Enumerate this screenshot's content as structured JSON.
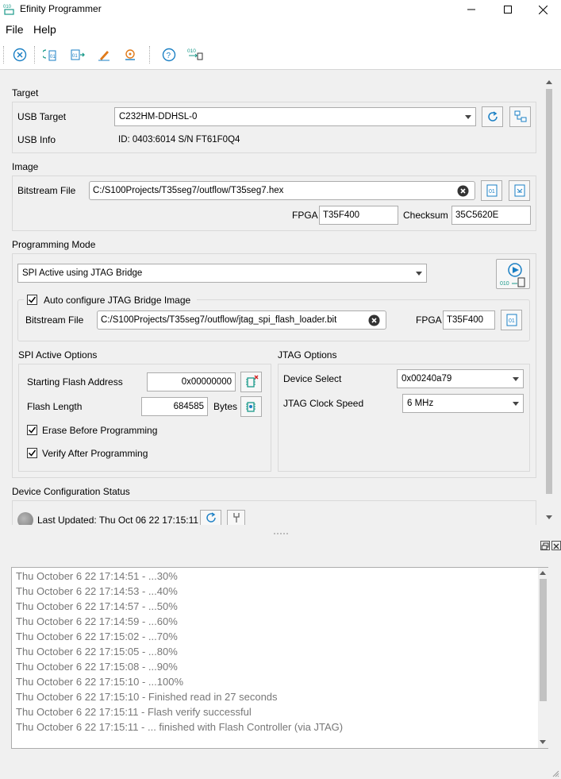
{
  "window": {
    "title": "Efinity Programmer"
  },
  "menu": {
    "items": [
      {
        "label": "File"
      },
      {
        "label": "Help"
      }
    ]
  },
  "target": {
    "section_title": "Target",
    "usb_target_label": "USB Target",
    "usb_target_value": "C232HM-DDHSL-0",
    "usb_info_label": "USB Info",
    "usb_info_value": "ID: 0403:6014 S/N FT61F0Q4"
  },
  "image": {
    "section_title": "Image",
    "bitstream_label": "Bitstream File",
    "bitstream_value": "C:/S100Projects/T35seg7/outflow/T35seg7.hex",
    "fpga_label": "FPGA",
    "fpga_value": "T35F400",
    "checksum_label": "Checksum",
    "checksum_value": "35C5620E"
  },
  "programming_mode": {
    "section_title": "Programming Mode",
    "mode_value": "SPI Active using JTAG Bridge",
    "auto_config_label": "Auto configure JTAG Bridge Image",
    "auto_config_checked": true,
    "bridge_bitstream_label": "Bitstream File",
    "bridge_bitstream_value": "C:/S100Projects/T35seg7/outflow/jtag_spi_flash_loader.bit",
    "bridge_fpga_label": "FPGA",
    "bridge_fpga_value": "T35F400",
    "program_icon_text": "010"
  },
  "spi_options": {
    "section_title": "SPI Active Options",
    "start_addr_label": "Starting Flash Address",
    "start_addr_value": "0x00000000",
    "flash_length_label": "Flash Length",
    "flash_length_value": "684585",
    "flash_length_unit": "Bytes",
    "erase_label": "Erase Before Programming",
    "erase_checked": true,
    "verify_label": "Verify After Programming",
    "verify_checked": true
  },
  "jtag_options": {
    "section_title": "JTAG Options",
    "device_select_label": "Device Select",
    "device_select_value": "0x00240a79",
    "clock_label": "JTAG Clock Speed",
    "clock_value": "6 MHz"
  },
  "device_status": {
    "section_title": "Device Configuration Status",
    "last_updated": "Last Updated: Thu Oct 06 22 17:15:11"
  },
  "toolbar_icons": {
    "bin_text_1": "01",
    "bin_text_2": "01",
    "bin_text_3": "010"
  },
  "log": {
    "lines": [
      "Thu October 6 22 17:14:51 - ...30%",
      "Thu October 6 22 17:14:53 - ...40%",
      "Thu October 6 22 17:14:57 - ...50%",
      "Thu October 6 22 17:14:59 - ...60%",
      "Thu October 6 22 17:15:02 - ...70%",
      "Thu October 6 22 17:15:05 - ...80%",
      "Thu October 6 22 17:15:08 - ...90%",
      "Thu October 6 22 17:15:10 - ...100%",
      "Thu October 6 22 17:15:10 - Finished read in 27 seconds",
      "Thu October 6 22 17:15:11 - Flash verify successful",
      "Thu October 6 22 17:15:11 - ... finished with Flash Controller (via JTAG)"
    ]
  },
  "colors": {
    "accent": "#1a7fc4",
    "teal": "#1a9a8a",
    "orange": "#e07a1a",
    "log_text": "#777777"
  }
}
